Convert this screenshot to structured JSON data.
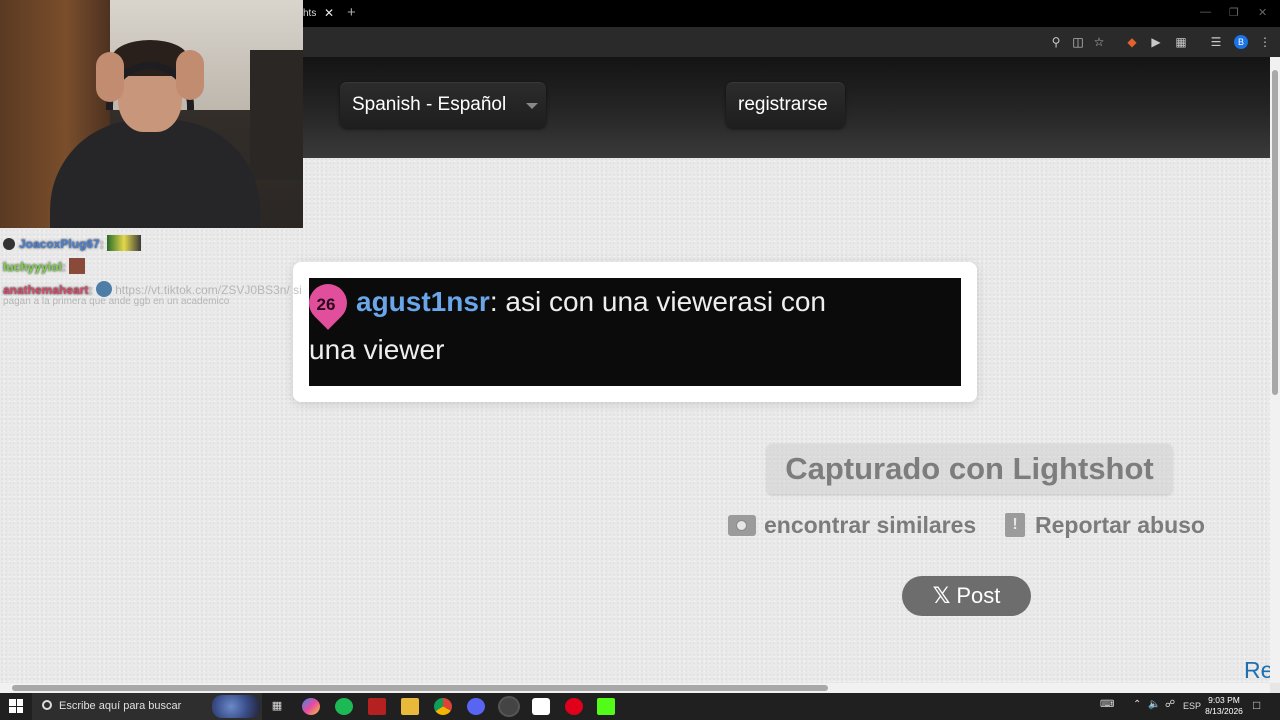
{
  "browser": {
    "tab_fragment": "hts",
    "tab_close": "✕",
    "new_tab": "+",
    "window_controls": [
      "—",
      "❐",
      "✕"
    ],
    "toolbar_icons": [
      "zoom-icon",
      "cast-icon",
      "star-icon",
      "extension-fox-icon",
      "extension-play-icon",
      "extensions-icon",
      "media-icon"
    ],
    "profile_initial": "B"
  },
  "page": {
    "language_button": "Spanish - Español",
    "register_button": "registrarse",
    "screenshot": {
      "badge_number": "26",
      "username": "agust1nsr",
      "line1_message": ": asi con una viewerasi con",
      "line2_message": "una viewer"
    },
    "captured_label": "Capturado con Lightshot",
    "similar_link": "encontrar similares",
    "report_link": "Reportar abuso",
    "post_button": "Post",
    "post_glyph": "𝕏",
    "corner_fragment": "Re"
  },
  "stream_overlay": {
    "chat": [
      {
        "user": "JoacoxPlug67",
        "color": "#4a7fd6",
        "sep": ":"
      },
      {
        "user": "luchyyyiol",
        "color": "#7ed34a",
        "sep": ":"
      },
      {
        "user": "anathemaheart",
        "color": "#d64a6a",
        "sep": ":",
        "faded_text": "https://vt.tiktok.com/ZSVJ0BS3n/ si"
      },
      {
        "faded_text": "pagan a la primera que ande ggb en un academico"
      }
    ]
  },
  "taskbar": {
    "search_placeholder": "Escribe aquí para buscar",
    "apps": [
      "task-view-icon",
      "copilot-icon",
      "spotify-icon",
      "video-app-icon",
      "file-explorer-icon",
      "chrome-icon",
      "discord-icon",
      "obs-icon",
      "roblox-icon",
      "opera-icon",
      "kick-icon"
    ],
    "language": "ESP",
    "time": "9:03 PM",
    "date": "8/13/2026"
  }
}
